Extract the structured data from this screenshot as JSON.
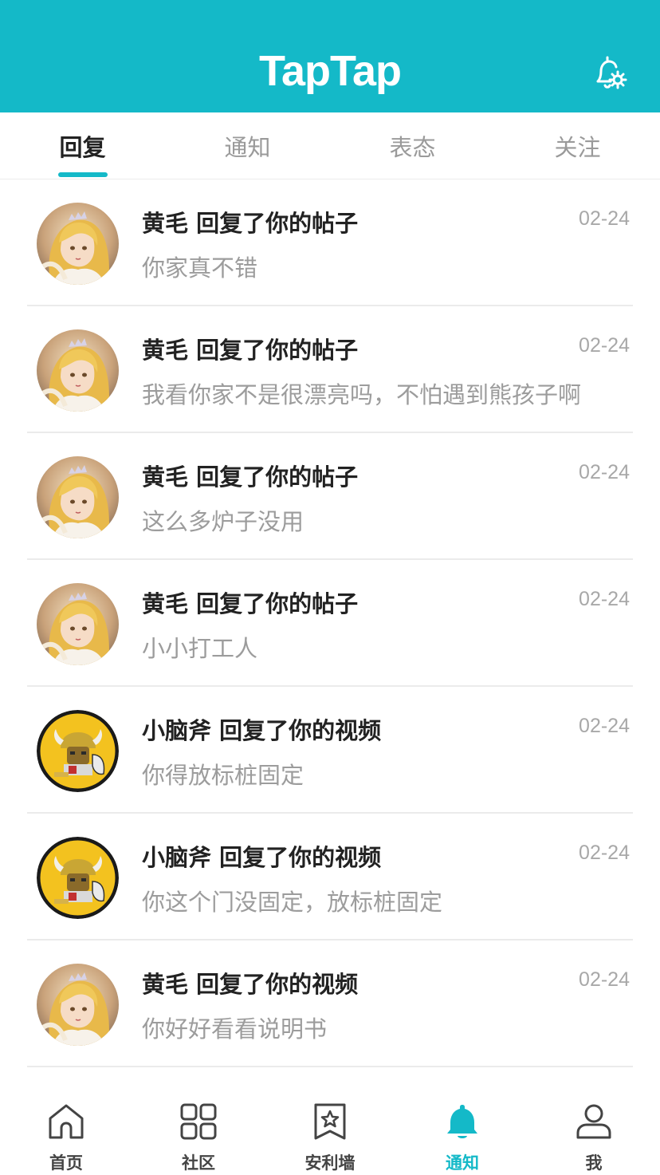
{
  "header": {
    "logo": "TapTap",
    "settings_icon": "bell-settings-icon"
  },
  "tabs": [
    {
      "label": "回复",
      "active": true
    },
    {
      "label": "通知",
      "active": false
    },
    {
      "label": "表态",
      "active": false
    },
    {
      "label": "关注",
      "active": false
    }
  ],
  "notifications": [
    {
      "title": "黄毛 回复了你的帖子",
      "date": "02-24",
      "message": "你家真不错",
      "avatar": "blonde-girl-avatar"
    },
    {
      "title": "黄毛 回复了你的帖子",
      "date": "02-24",
      "message": "我看你家不是很漂亮吗，不怕遇到熊孩子啊",
      "avatar": "blonde-girl-avatar"
    },
    {
      "title": "黄毛 回复了你的帖子",
      "date": "02-24",
      "message": "这么多炉子没用",
      "avatar": "blonde-girl-avatar"
    },
    {
      "title": "黄毛 回复了你的帖子",
      "date": "02-24",
      "message": "小小打工人",
      "avatar": "blonde-girl-avatar"
    },
    {
      "title": "小脑斧 回复了你的视频",
      "date": "02-24",
      "message": "你得放标桩固定",
      "avatar": "viking-avatar"
    },
    {
      "title": "小脑斧 回复了你的视频",
      "date": "02-24",
      "message": "你这个门没固定，放标桩固定",
      "avatar": "viking-avatar"
    },
    {
      "title": "黄毛 回复了你的视频",
      "date": "02-24",
      "message": "你好好看看说明书",
      "avatar": "blonde-girl-avatar"
    }
  ],
  "bottom_nav": [
    {
      "label": "首页",
      "icon": "home-icon",
      "active": false
    },
    {
      "label": "社区",
      "icon": "grid-icon",
      "active": false
    },
    {
      "label": "安利墙",
      "icon": "star-bookmark-icon",
      "active": false
    },
    {
      "label": "通知",
      "icon": "bell-icon",
      "active": true
    },
    {
      "label": "我",
      "icon": "user-icon",
      "active": false
    }
  ],
  "colors": {
    "accent": "#14b9c8",
    "title_text": "#222222",
    "secondary_text": "#9c9c9c"
  }
}
